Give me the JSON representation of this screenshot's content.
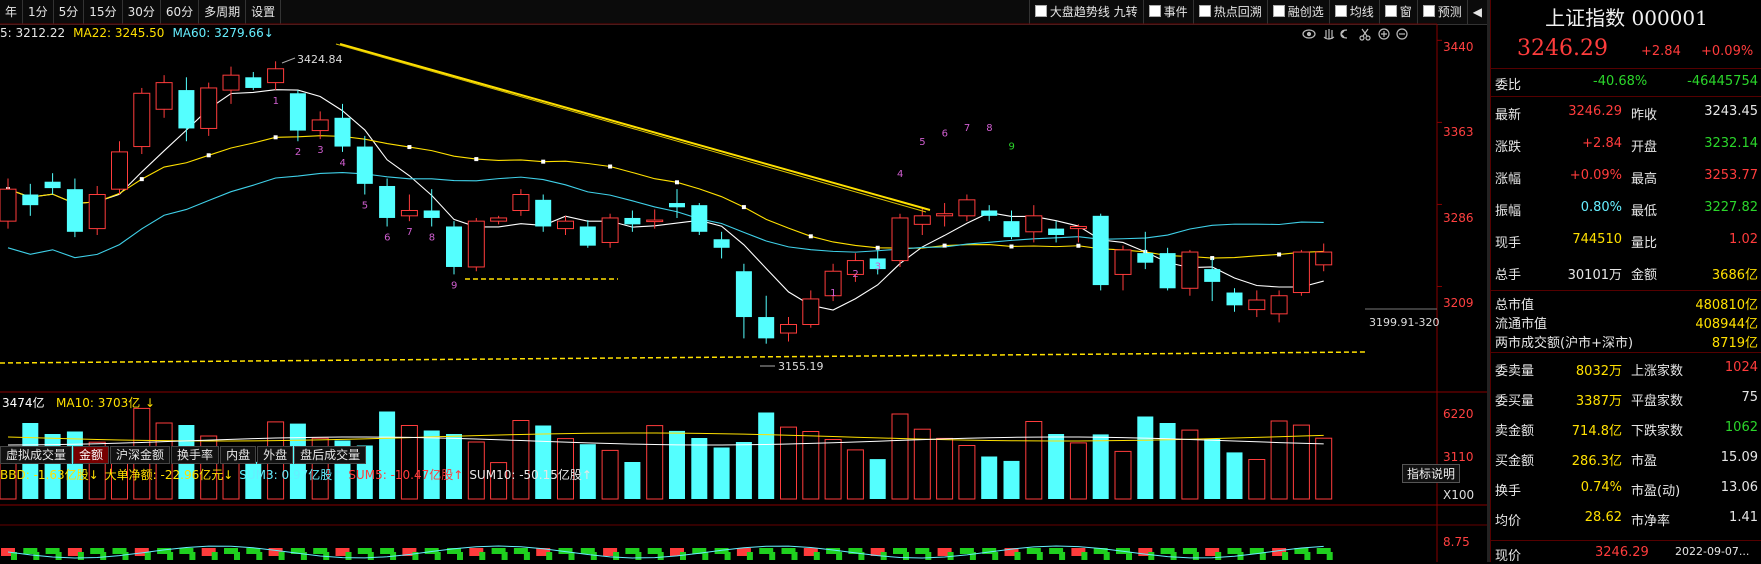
{
  "topbar": {
    "periods": [
      "年",
      "1分",
      "5分",
      "15分",
      "30分",
      "60分",
      "多周期",
      "设置"
    ],
    "tools": [
      "大盘趋势线 九转",
      "事件",
      "热点回溯",
      "融创选",
      "均线",
      "窗",
      "预测"
    ],
    "tool_checkbox": [
      true,
      false,
      true,
      true,
      false,
      false,
      false
    ]
  },
  "ma_legend": {
    "ma5": "5: 3212.22",
    "ma22": "MA22: 3245.50",
    "ma60": "MA60: 3279.66",
    "ma60_arrow": "↓"
  },
  "price_axis": [
    "3440",
    "3363",
    "3286",
    "3209"
  ],
  "volume_axis": [
    "6220",
    "3110",
    "X100"
  ],
  "price_labels": {
    "high": "3424.84",
    "low": "3155.19",
    "right": "3199.91-320"
  },
  "td_labels_top": [
    "1",
    "2",
    "3",
    "4",
    "5",
    "6",
    "7",
    "8",
    "9"
  ],
  "td_labels_down": [
    "1",
    "2",
    "3",
    "4",
    "5",
    "6",
    "7",
    "8",
    "9"
  ],
  "volume_legend": {
    "vol": "3474亿",
    "ma10": "MA10: 3703亿",
    "arrow": "↓"
  },
  "bottom_tabs": [
    "虚拟成交量",
    "金额",
    "沪深金额",
    "换手率",
    "内盘",
    "外盘",
    "盘后成交量"
  ],
  "active_tab": 1,
  "flow_row": {
    "bbd": "BBD: -1.63亿股↓",
    "net": "大单净额: -22.96亿元↓",
    "sum3": "SUM3: 0.97亿股↑",
    "sum5": "SUM5: -10.47亿股↑",
    "sum10": "SUM10: -50.15亿股↑",
    "axis": "8.75",
    "button": "指标说明"
  },
  "colors": {
    "up": "#ff3c3c",
    "down": "#54ffff",
    "ma5": "#ffffff",
    "ma22": "#ffe000",
    "ma60": "#3fd0e8"
  },
  "quote": {
    "title": "上证指数 000001",
    "price": "3246.29",
    "change": "+2.84",
    "pct": "+0.09%",
    "weibi_label": "委比",
    "weibi": "-40.68%",
    "weicha": "-46445754",
    "rows": [
      {
        "l1": "最新",
        "v1": "3246.29",
        "c1": "red",
        "l2": "昨收",
        "v2": "3243.45",
        "c2": "white"
      },
      {
        "l1": "涨跌",
        "v1": "+2.84",
        "c1": "red",
        "l2": "开盘",
        "v2": "3232.14",
        "c2": "green"
      },
      {
        "l1": "涨幅",
        "v1": "+0.09%",
        "c1": "red",
        "l2": "最高",
        "v2": "3253.77",
        "c2": "red"
      },
      {
        "l1": "振幅",
        "v1": "0.80%",
        "c1": "cyan",
        "l2": "最低",
        "v2": "3227.82",
        "c2": "green"
      },
      {
        "l1": "现手",
        "v1": "744510",
        "c1": "yellow",
        "l2": "量比",
        "v2": "1.02",
        "c2": "red"
      },
      {
        "l1": "总手",
        "v1": "30101万",
        "c1": "white",
        "l2": "金额",
        "v2": "3686亿",
        "c2": "yellow"
      }
    ],
    "mkt": [
      {
        "l": "总市值",
        "v": "480810亿"
      },
      {
        "l": "流通市值",
        "v": "408944亿"
      },
      {
        "l": "两市成交额(沪市+深市)",
        "v": "8719亿"
      }
    ],
    "rows2": [
      {
        "l1": "委卖量",
        "v1": "8032万",
        "c1": "yellow",
        "l2": "上涨家数",
        "v2": "1024",
        "c2": "red"
      },
      {
        "l1": "委买量",
        "v1": "3387万",
        "c1": "yellow",
        "l2": "平盘家数",
        "v2": "75",
        "c2": "white"
      },
      {
        "l1": "卖金额",
        "v1": "714.8亿",
        "c1": "yellow",
        "l2": "下跌家数",
        "v2": "1062",
        "c2": "green"
      },
      {
        "l1": "买金额",
        "v1": "286.3亿",
        "c1": "yellow",
        "l2": "市盈",
        "v2": "15.09",
        "c2": "white"
      },
      {
        "l1": "换手",
        "v1": "0.74%",
        "c1": "yellow",
        "l2": "市盈(动)",
        "v2": "13.06",
        "c2": "white"
      },
      {
        "l1": "均价",
        "v1": "28.62",
        "c1": "yellow",
        "l2": "市净率",
        "v2": "1.41",
        "c2": "white"
      }
    ],
    "last_label": "现价",
    "last_price": "3246.29",
    "last_time": "2022-09-07..."
  },
  "candles": [
    [
      3275,
      3315,
      3268,
      3305
    ],
    [
      3300,
      3310,
      3280,
      3290
    ],
    [
      3312,
      3320,
      3300,
      3306
    ],
    [
      3305,
      3315,
      3260,
      3265
    ],
    [
      3268,
      3308,
      3262,
      3300
    ],
    [
      3305,
      3350,
      3300,
      3340
    ],
    [
      3345,
      3400,
      3338,
      3395
    ],
    [
      3380,
      3412,
      3372,
      3405
    ],
    [
      3398,
      3410,
      3350,
      3362
    ],
    [
      3362,
      3405,
      3355,
      3400
    ],
    [
      3398,
      3420,
      3385,
      3412
    ],
    [
      3410,
      3415,
      3398,
      3400
    ],
    [
      3405,
      3425,
      3398,
      3418
    ],
    [
      3395,
      3398,
      3350,
      3360
    ],
    [
      3360,
      3378,
      3352,
      3370
    ],
    [
      3372,
      3385,
      3340,
      3345
    ],
    [
      3345,
      3355,
      3300,
      3310
    ],
    [
      3308,
      3315,
      3270,
      3278
    ],
    [
      3280,
      3300,
      3275,
      3285
    ],
    [
      3285,
      3305,
      3270,
      3278
    ],
    [
      3270,
      3275,
      3225,
      3232
    ],
    [
      3232,
      3278,
      3228,
      3275
    ],
    [
      3275,
      3280,
      3272,
      3278
    ],
    [
      3285,
      3305,
      3280,
      3300
    ],
    [
      3295,
      3300,
      3265,
      3270
    ],
    [
      3268,
      3280,
      3262,
      3275
    ],
    [
      3270,
      3276,
      3250,
      3252
    ],
    [
      3255,
      3282,
      3250,
      3278
    ],
    [
      3278,
      3285,
      3265,
      3272
    ],
    [
      3275,
      3286,
      3268,
      3276
    ],
    [
      3292,
      3305,
      3278,
      3288
    ],
    [
      3290,
      3292,
      3262,
      3265
    ],
    [
      3258,
      3265,
      3240,
      3250
    ],
    [
      3228,
      3235,
      3165,
      3185
    ],
    [
      3185,
      3205,
      3160,
      3165
    ],
    [
      3170,
      3185,
      3162,
      3178
    ],
    [
      3178,
      3210,
      3175,
      3202
    ],
    [
      3205,
      3235,
      3200,
      3228
    ],
    [
      3225,
      3245,
      3218,
      3238
    ],
    [
      3240,
      3248,
      3225,
      3230
    ],
    [
      3238,
      3282,
      3232,
      3278
    ],
    [
      3272,
      3288,
      3262,
      3280
    ],
    [
      3280,
      3292,
      3270,
      3282
    ],
    [
      3280,
      3300,
      3275,
      3295
    ],
    [
      3285,
      3290,
      3275,
      3280
    ],
    [
      3275,
      3285,
      3258,
      3260
    ],
    [
      3265,
      3290,
      3255,
      3280
    ],
    [
      3268,
      3275,
      3255,
      3262
    ],
    [
      3268,
      3272,
      3255,
      3270
    ],
    [
      3280,
      3282,
      3210,
      3215
    ],
    [
      3225,
      3252,
      3210,
      3248
    ],
    [
      3245,
      3265,
      3230,
      3236
    ],
    [
      3245,
      3250,
      3210,
      3212
    ],
    [
      3212,
      3248,
      3205,
      3246
    ],
    [
      3230,
      3240,
      3200,
      3218
    ],
    [
      3208,
      3212,
      3190,
      3196
    ],
    [
      3192,
      3210,
      3185,
      3201
    ],
    [
      3188,
      3210,
      3180,
      3205
    ],
    [
      3208,
      3248,
      3205,
      3246
    ],
    [
      3234,
      3254,
      3228,
      3246
    ]
  ]
}
